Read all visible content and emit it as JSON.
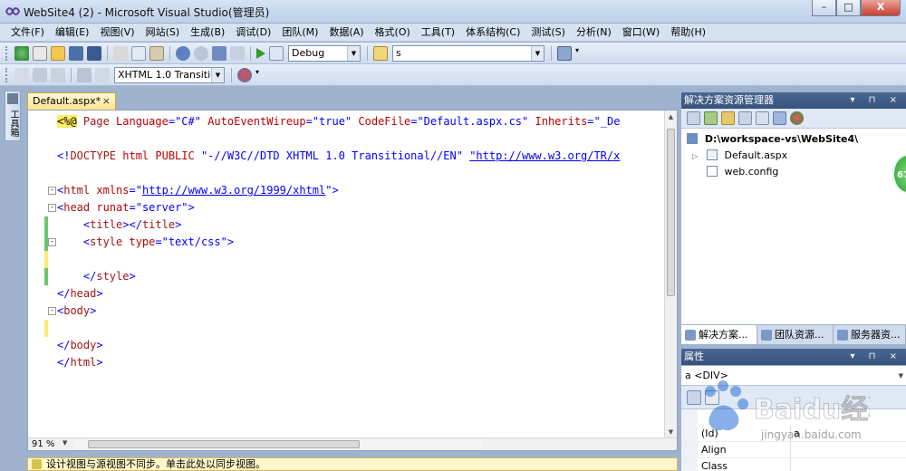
{
  "window": {
    "title": "WebSite4 (2) - Microsoft Visual Studio(管理员)",
    "minimize": "–",
    "maximize": "□",
    "close": "X"
  },
  "menu": [
    "文件(F)",
    "编辑(E)",
    "视图(V)",
    "网站(S)",
    "生成(B)",
    "调试(D)",
    "团队(M)",
    "数据(A)",
    "格式(O)",
    "工具(T)",
    "体系结构(C)",
    "测试(S)",
    "分析(N)",
    "窗口(W)",
    "帮助(H)"
  ],
  "toolbar": {
    "config_value": "Debug",
    "search_value": "s",
    "schema_value": "XHTML 1.0 Transitic"
  },
  "toolbox": {
    "label": "工具箱"
  },
  "editor": {
    "tab_label": "Default.aspx*",
    "tab_close": "×",
    "zoom": "91 %",
    "lines": [
      {
        "tokens": [
          {
            "t": "<%@",
            "c": "dir"
          },
          {
            "t": " Page ",
            "c": "kw"
          },
          {
            "t": "Language",
            "c": "attr"
          },
          {
            "t": "=",
            "c": "pun"
          },
          {
            "t": "\"C#\"",
            "c": "val"
          },
          {
            "t": " AutoEventWireup",
            "c": "attr"
          },
          {
            "t": "=",
            "c": "pun"
          },
          {
            "t": "\"true\"",
            "c": "val"
          },
          {
            "t": " CodeFile",
            "c": "attr"
          },
          {
            "t": "=",
            "c": "pun"
          },
          {
            "t": "\"Default.aspx.cs\"",
            "c": "val"
          },
          {
            "t": " Inherits",
            "c": "attr"
          },
          {
            "t": "=",
            "c": "pun"
          },
          {
            "t": "\"_De",
            "c": "val"
          }
        ]
      },
      {
        "tokens": []
      },
      {
        "tokens": [
          {
            "t": "<!",
            "c": "pun"
          },
          {
            "t": "DOCTYPE",
            "c": "kw"
          },
          {
            "t": " html",
            "c": "attr"
          },
          {
            "t": " PUBLIC",
            "c": "attr"
          },
          {
            "t": " \"-//W3C//DTD XHTML 1.0 Transitional//EN\"",
            "c": "val"
          },
          {
            "t": " ",
            "c": "val"
          },
          {
            "t": "\"http://www.w3.org/TR/x",
            "c": "url"
          }
        ]
      },
      {
        "tokens": []
      },
      {
        "tokens": [
          {
            "t": "<",
            "c": "pun"
          },
          {
            "t": "html",
            "c": "kw"
          },
          {
            "t": " xmlns",
            "c": "attr"
          },
          {
            "t": "=",
            "c": "pun"
          },
          {
            "t": "\"",
            "c": "val"
          },
          {
            "t": "http://www.w3.org/1999/xhtml",
            "c": "url"
          },
          {
            "t": "\">",
            "c": "val"
          }
        ]
      },
      {
        "tokens": [
          {
            "t": "<",
            "c": "pun"
          },
          {
            "t": "head",
            "c": "kw"
          },
          {
            "t": " runat",
            "c": "attr"
          },
          {
            "t": "=",
            "c": "pun"
          },
          {
            "t": "\"server\"",
            "c": "val"
          },
          {
            "t": ">",
            "c": "pun"
          }
        ]
      },
      {
        "tokens": [
          {
            "t": "    <",
            "c": "pun"
          },
          {
            "t": "title",
            "c": "kw"
          },
          {
            "t": "></",
            "c": "pun"
          },
          {
            "t": "title",
            "c": "kw"
          },
          {
            "t": ">",
            "c": "pun"
          }
        ]
      },
      {
        "tokens": [
          {
            "t": "    <",
            "c": "pun"
          },
          {
            "t": "style",
            "c": "kw"
          },
          {
            "t": " type",
            "c": "attr"
          },
          {
            "t": "=",
            "c": "pun"
          },
          {
            "t": "\"text/css\"",
            "c": "val"
          },
          {
            "t": ">",
            "c": "pun"
          }
        ]
      },
      {
        "tokens": []
      },
      {
        "tokens": [
          {
            "t": "    </",
            "c": "pun"
          },
          {
            "t": "style",
            "c": "kw"
          },
          {
            "t": ">",
            "c": "pun"
          }
        ]
      },
      {
        "tokens": [
          {
            "t": "</",
            "c": "pun"
          },
          {
            "t": "head",
            "c": "kw"
          },
          {
            "t": ">",
            "c": "pun"
          }
        ]
      },
      {
        "tokens": [
          {
            "t": "<",
            "c": "pun"
          },
          {
            "t": "body",
            "c": "kw"
          },
          {
            "t": ">",
            "c": "pun"
          }
        ]
      },
      {
        "tokens": []
      },
      {
        "tokens": [
          {
            "t": "</",
            "c": "pun"
          },
          {
            "t": "body",
            "c": "kw"
          },
          {
            "t": ">",
            "c": "pun"
          }
        ]
      },
      {
        "tokens": [
          {
            "t": "</",
            "c": "pun"
          },
          {
            "t": "html",
            "c": "kw"
          },
          {
            "t": ">",
            "c": "pun"
          }
        ]
      }
    ]
  },
  "status": {
    "message": "设计视图与源视图不同步。单击此处以同步视图。"
  },
  "solution_explorer": {
    "title": "解决方案资源管理器",
    "header_buttons": "▾ ⊓ ×",
    "root": "D:\\workspace-vs\\WebSite4\\",
    "items": [
      "Default.aspx",
      "web.config"
    ],
    "badge": "67",
    "tabs": [
      "解决方案...",
      "团队资源...",
      "服务器资..."
    ]
  },
  "properties": {
    "title": "属性",
    "header_buttons": "▾ ⊓ ×",
    "selected": "a <DIV>",
    "rows": [
      {
        "name": "(Id)",
        "value": "a"
      },
      {
        "name": "Align",
        "value": ""
      },
      {
        "name": "Class",
        "value": ""
      }
    ]
  },
  "watermark": {
    "text": "Baidu经验",
    "subtext": "jingyan.baidu.com"
  },
  "colors": {
    "accent": "#36527d",
    "tab_active": "#ffe48e",
    "change_yellow": "#fde977",
    "change_green": "#6bc66b"
  }
}
